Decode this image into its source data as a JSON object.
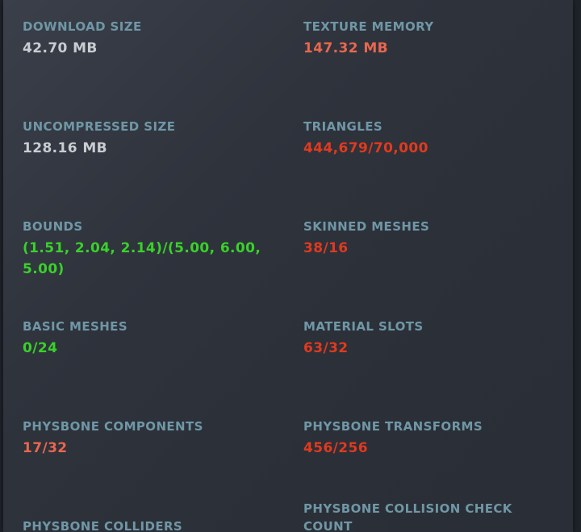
{
  "stats": {
    "download_size": {
      "label": "DOWNLOAD SIZE",
      "value": "42.70 MB",
      "status": "neutral"
    },
    "texture_memory": {
      "label": "TEXTURE MEMORY",
      "value": "147.32 MB",
      "status": "warn"
    },
    "uncompressed_size": {
      "label": "UNCOMPRESSED SIZE",
      "value": "128.16 MB",
      "status": "neutral"
    },
    "triangles": {
      "label": "TRIANGLES",
      "value": "444,679/70,000",
      "status": "bad"
    },
    "bounds": {
      "label": "BOUNDS",
      "value": "(1.51, 2.04, 2.14)/(5.00, 6.00, 5.00)",
      "status": "good"
    },
    "skinned_meshes": {
      "label": "SKINNED MESHES",
      "value": "38/16",
      "status": "bad"
    },
    "basic_meshes": {
      "label": "BASIC MESHES",
      "value": "0/24",
      "status": "good"
    },
    "material_slots": {
      "label": "MATERIAL SLOTS",
      "value": "63/32",
      "status": "bad"
    },
    "physbone_components": {
      "label": "PHYSBONE COMPONENTS",
      "value": "17/32",
      "status": "warn"
    },
    "physbone_transforms": {
      "label": "PHYSBONE TRANSFORMS",
      "value": "456/256",
      "status": "bad"
    },
    "physbone_colliders": {
      "label": "PHYSBONE COLLIDERS"
    },
    "physbone_collision_check": {
      "label": "PHYSBONE COLLISION CHECK COUNT"
    }
  },
  "colors": {
    "label": "#6f97a6",
    "neutral": "#c9cdd2",
    "warn": "#e8674f",
    "bad": "#e03a1f",
    "good": "#39d12a"
  }
}
